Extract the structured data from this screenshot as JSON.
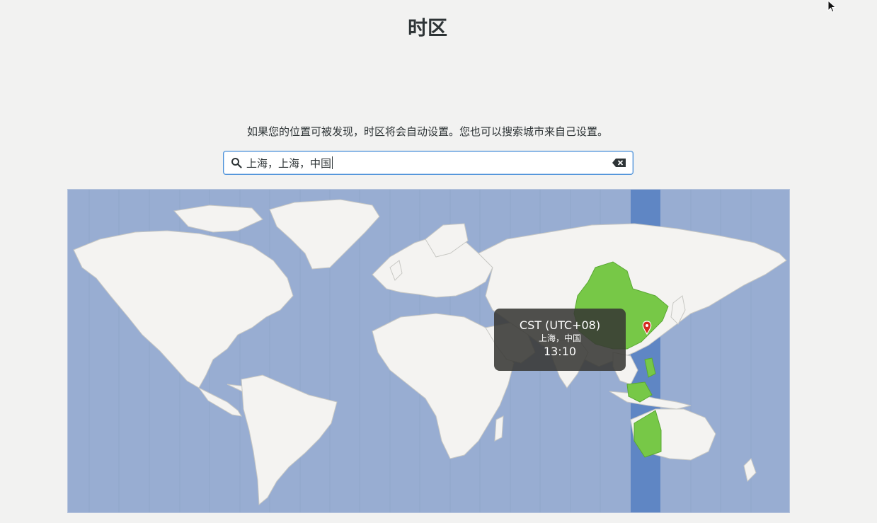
{
  "page": {
    "title": "时区",
    "description": "如果您的位置可被发现，时区将会自动设置。您也可以搜索城市来自己设置。"
  },
  "search": {
    "value": "上海，上海，中国",
    "icon": "search-icon",
    "clear_icon": "clear-text-icon"
  },
  "map": {
    "highlight_color": "#77c847",
    "ocean_color": "#98add2",
    "land_color": "#f4f3f1",
    "selected_band_color": "#5f86c4"
  },
  "tooltip": {
    "timezone": "CST (UTC+08)",
    "location": "上海，中国",
    "time": "13:10"
  }
}
